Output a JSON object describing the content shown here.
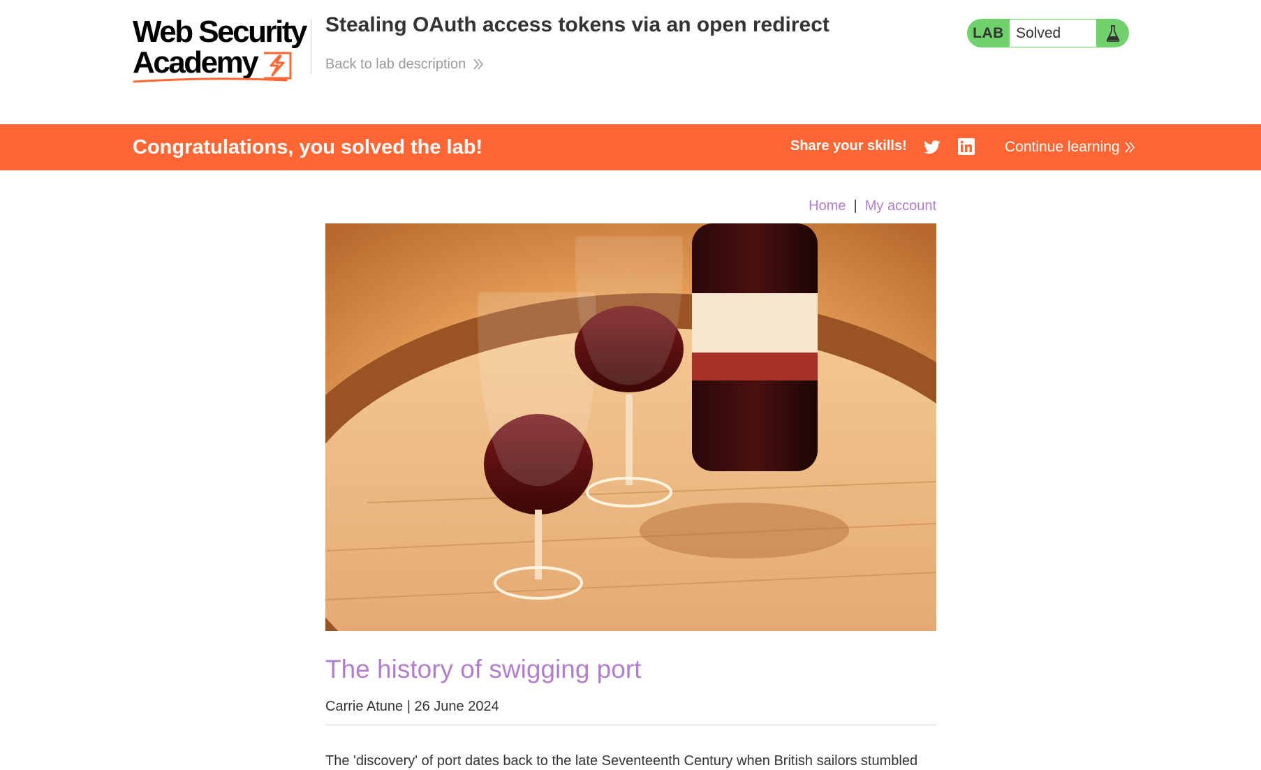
{
  "academy_header": {
    "logo_line1": "Web Security",
    "logo_line2": "Academy",
    "lab_title": "Stealing OAuth access tokens via an open redirect",
    "back_link": "Back to lab description",
    "lab_status": {
      "tag": "LAB",
      "state": "Solved",
      "icon": "flask-icon"
    }
  },
  "solved_banner": {
    "message": "Congratulations, you solved the lab!",
    "share_label": "Share your skills!",
    "twitter_icon": "twitter-icon",
    "linkedin_icon": "linkedin-icon",
    "continue_label": "Continue learning"
  },
  "nav": {
    "home": "Home",
    "separator": "|",
    "my_account": "My account"
  },
  "post": {
    "title": "The history of swigging port",
    "meta": "Carrie Atune | 26 June 2024",
    "body_first_line": "The 'discovery' of port dates back to the late Seventeenth Century when British sailors stumbled"
  },
  "colors": {
    "accent_orange": "#ff6633",
    "lab_green": "#70d16d",
    "link_purple": "#b17ecd",
    "text_dark": "#333332",
    "muted_grey": "#999999"
  }
}
